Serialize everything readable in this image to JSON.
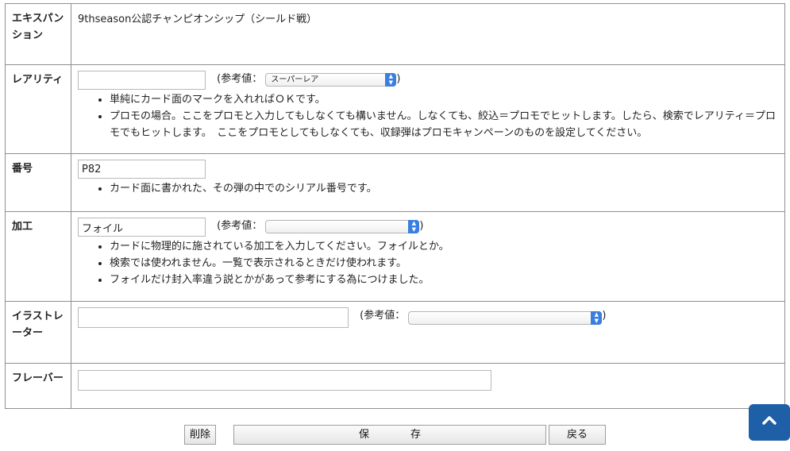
{
  "rows": {
    "expansion": {
      "label": "エキスパンション",
      "value": "9thseason公認チャンピオンシップ（シールド戦）"
    },
    "rarity": {
      "label": "レアリティ",
      "input_value": "",
      "ref_label": "(参考値：",
      "ref_close": ")",
      "select_value": "スーパーレア",
      "notes": [
        "単純にカード面のマークを入れればＯＫです。",
        "プロモの場合。ここをプロモと入力してもしなくても構いません。しなくても、絞込＝プロモでヒットします。したら、検索でレアリティ＝プロモでもヒットします。　ここをプロモとしてもしなくても、収録弾はプロモキャンペーンのものを設定してください。"
      ]
    },
    "number": {
      "label": "番号",
      "input_value": "P82",
      "notes": [
        "カード面に書かれた、その弾の中でのシリアル番号です。"
      ]
    },
    "finish": {
      "label": "加工",
      "input_value": "フォイル",
      "ref_label": "(参考値：",
      "ref_close": ")",
      "select_value": "",
      "notes": [
        "カードに物理的に施されている加工を入力してください。フォイルとか。",
        "検索では使われません。一覧で表示されるときだけ使われます。",
        "フォイルだけ封入率違う説とかがあって参考にする為につけました。"
      ]
    },
    "illustrator": {
      "label": "イラストレーター",
      "input_value": "",
      "ref_label": "(参考値：",
      "ref_close": ")",
      "select_value": ""
    },
    "flavor": {
      "label": "フレーバー",
      "input_value": ""
    }
  },
  "buttons": {
    "delete": "削除",
    "save": "保　　　　存",
    "back": "戻る"
  },
  "icons": {
    "scroll_top": "chevron-up-icon",
    "select_arrow": "up-down-arrows-icon"
  },
  "colors": {
    "select_arrow": "#3a7fe0",
    "scroll_top": "#1e5fa8",
    "border": "#8f8f8f"
  }
}
